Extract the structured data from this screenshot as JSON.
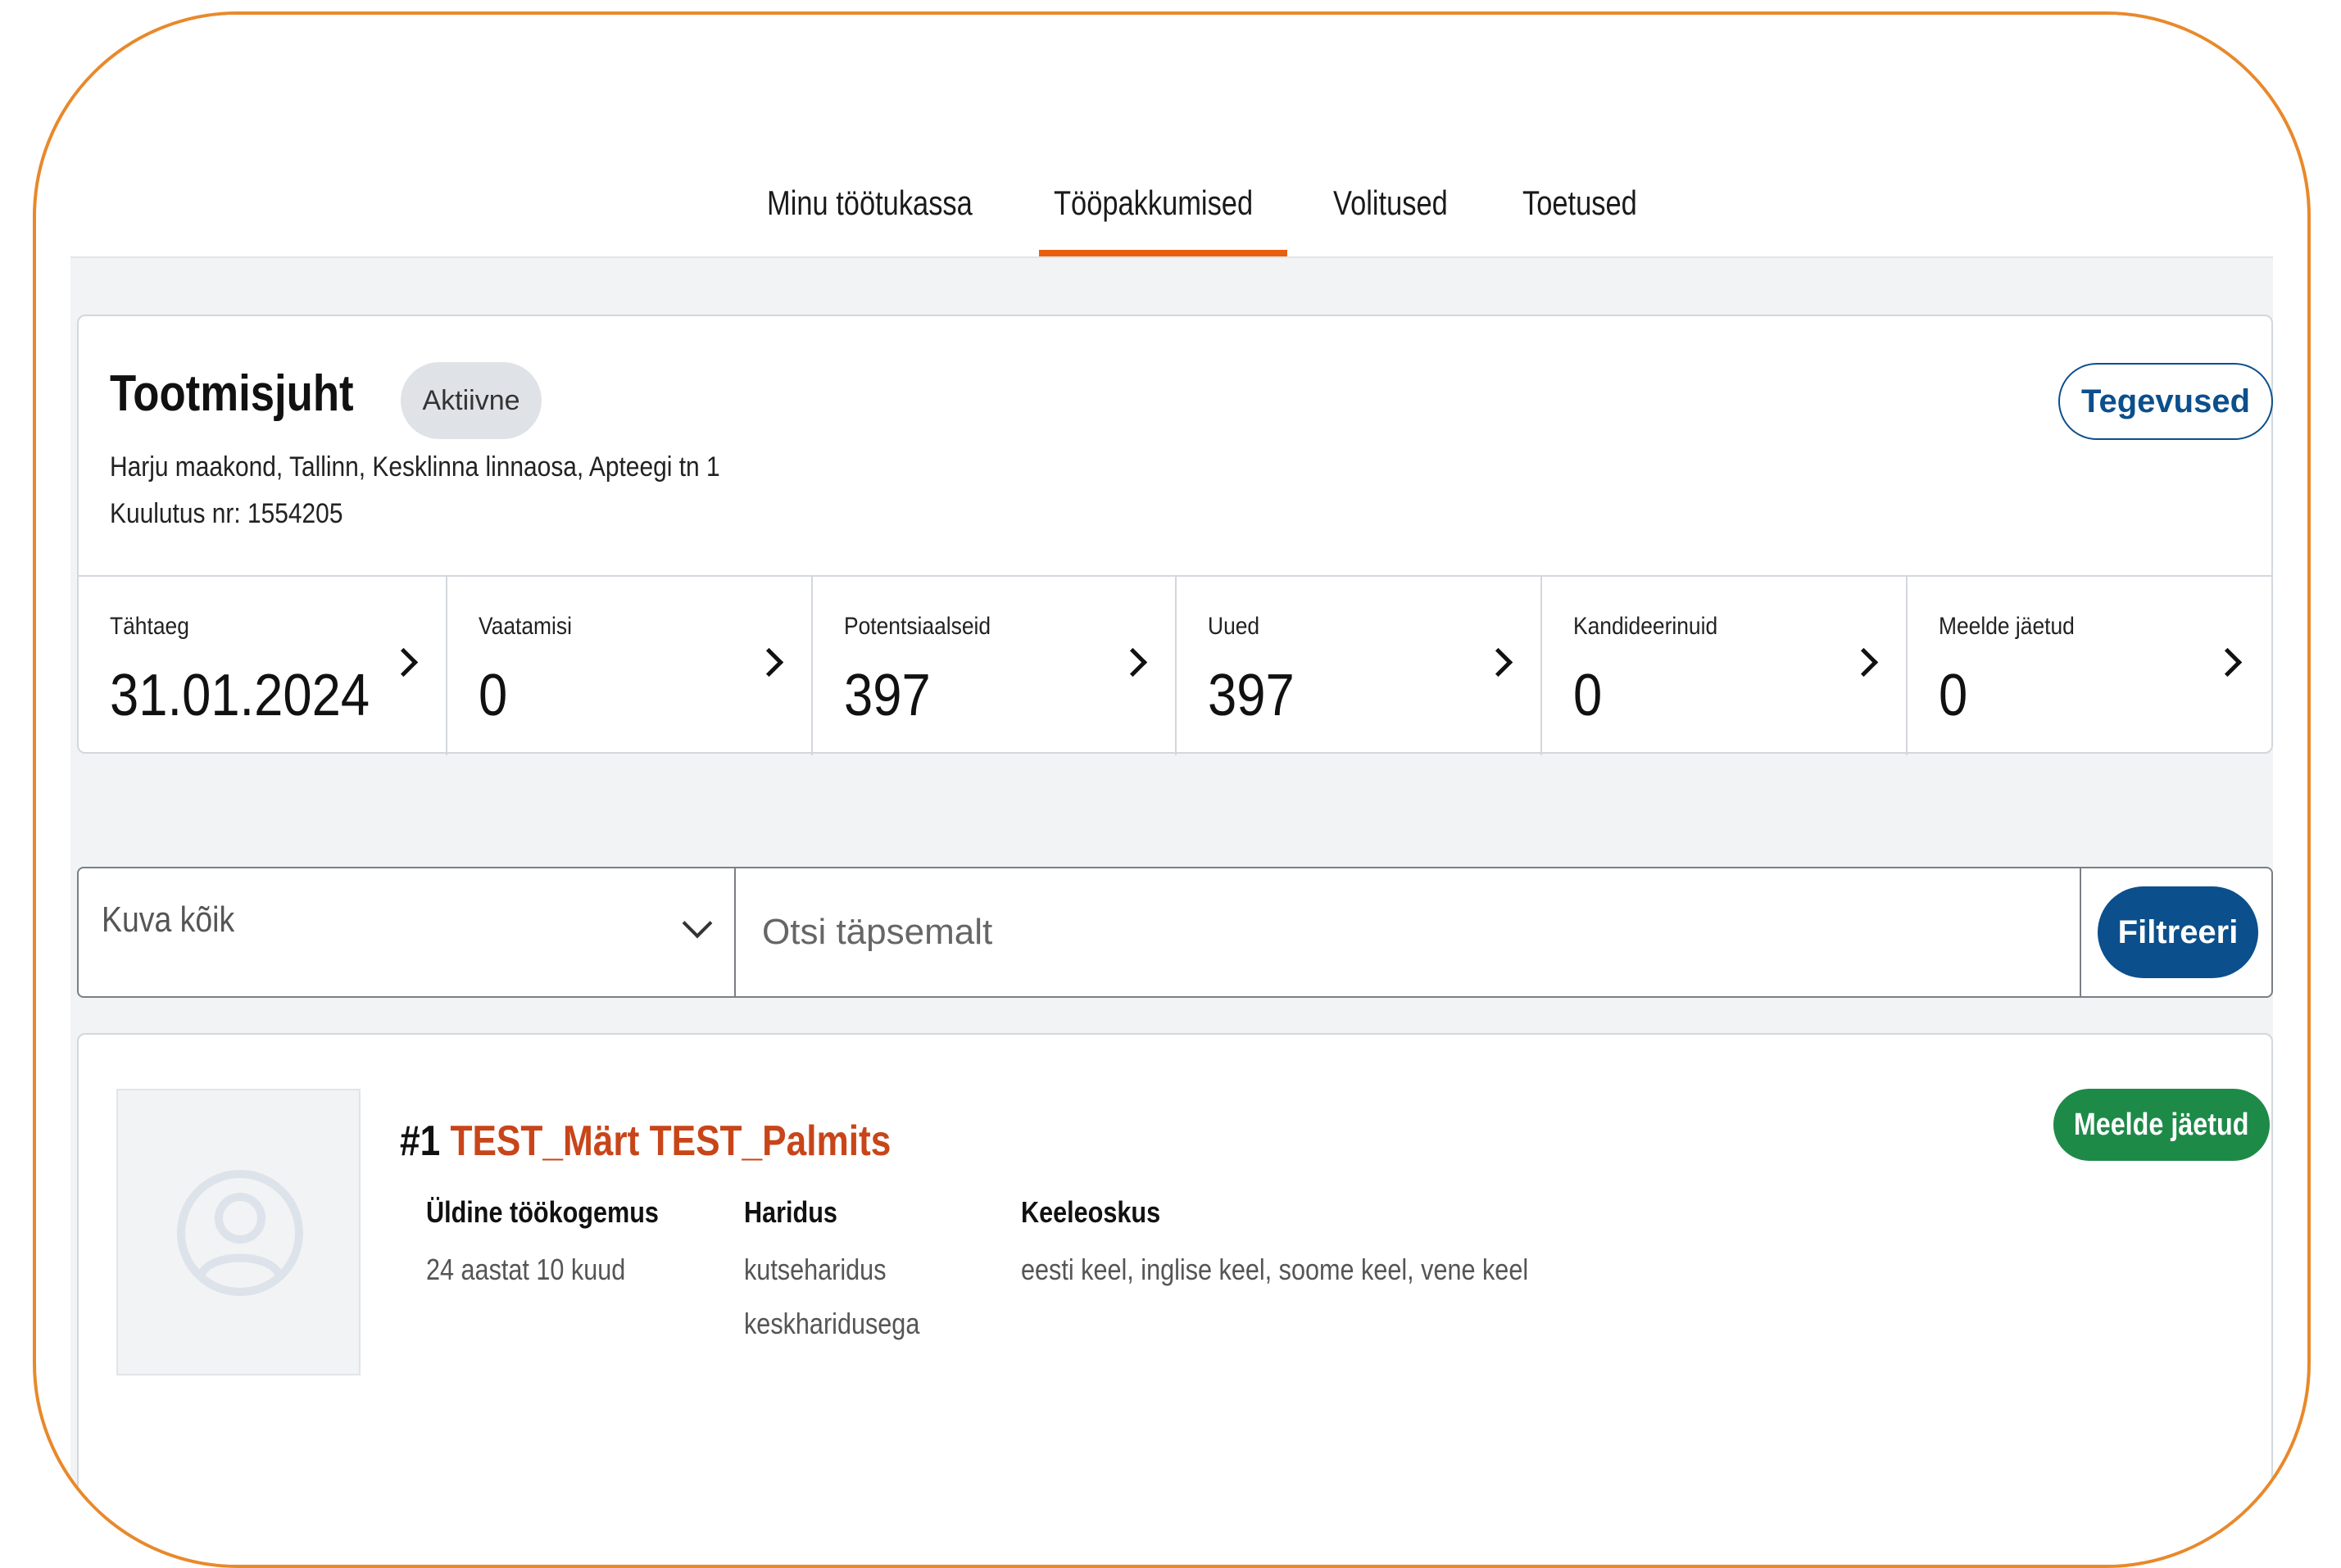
{
  "nav": {
    "items": [
      {
        "label": "Minu töötukassa"
      },
      {
        "label": "Tööpakkumised"
      },
      {
        "label": "Volitused"
      },
      {
        "label": "Toetused"
      }
    ]
  },
  "job": {
    "title": "Tootmisjuht",
    "status": "Aktiivne",
    "actions_label": "Tegevused",
    "address": "Harju maakond, Tallinn, Kesklinna linnaosa, Apteegi tn 1",
    "ad_number": "Kuulutus nr: 1554205",
    "stats": [
      {
        "label": "Tähtaeg",
        "value": "31.01.2024"
      },
      {
        "label": "Vaatamisi",
        "value": "0"
      },
      {
        "label": "Potentsiaalseid",
        "value": "397"
      },
      {
        "label": "Uued",
        "value": "397"
      },
      {
        "label": "Kandideerinuid",
        "value": "0"
      },
      {
        "label": "Meelde jäetud",
        "value": "0"
      }
    ]
  },
  "filter": {
    "select_value": "Kuva kõik",
    "search_placeholder": "Otsi täpsemalt",
    "button_label": "Filtreeri"
  },
  "candidate": {
    "number": "#1",
    "name": "TEST_Märt TEST_Palmits",
    "badge": "Meelde jäetud",
    "experience_label": "Üldine töökogemus",
    "experience_value": "24 aastat 10 kuud",
    "education_label": "Haridus",
    "education_value_1": "kutseharidus",
    "education_value_2": "keskharidusega",
    "languages_label": "Keeleoskus",
    "languages_value": "eesti keel, inglise keel, soome keel, vene keel"
  },
  "colors": {
    "accent": "#e8600f",
    "primary": "#0b4f8c",
    "link": "#c8451a",
    "success": "#1e8a48",
    "frame": "#e8892b"
  }
}
